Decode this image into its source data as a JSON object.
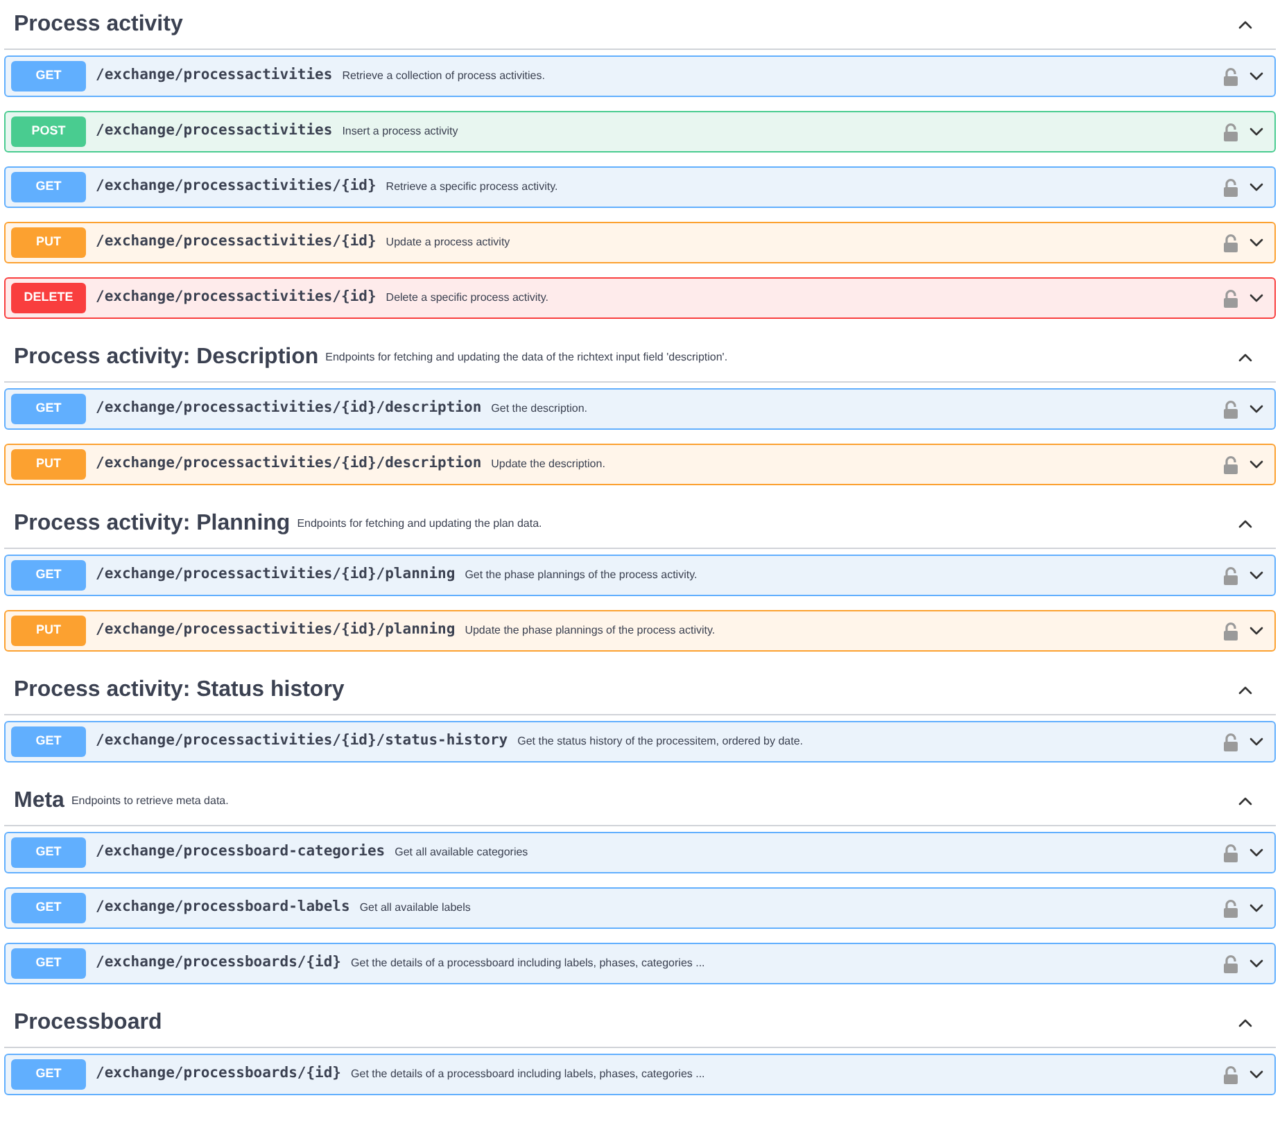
{
  "sections": [
    {
      "title": "Process activity",
      "expanded": true,
      "operations": [
        {
          "method": "GET",
          "path": "/exchange/processactivities",
          "summary": "Retrieve a collection of process activities."
        },
        {
          "method": "POST",
          "path": "/exchange/processactivities",
          "summary": "Insert a process activity"
        },
        {
          "method": "GET",
          "path": "/exchange/processactivities/{id}",
          "summary": "Retrieve a specific process activity."
        },
        {
          "method": "PUT",
          "path": "/exchange/processactivities/{id}",
          "summary": "Update a process activity"
        },
        {
          "method": "DELETE",
          "path": "/exchange/processactivities/{id}",
          "summary": "Delete a specific process activity."
        }
      ]
    },
    {
      "title": "Process activity: Description",
      "description": "Endpoints for fetching and updating the data of the richtext input field 'description'.",
      "expanded": true,
      "operations": [
        {
          "method": "GET",
          "path": "/exchange/processactivities/{id}/description",
          "summary": "Get the description."
        },
        {
          "method": "PUT",
          "path": "/exchange/processactivities/{id}/description",
          "summary": "Update the description."
        }
      ]
    },
    {
      "title": "Process activity: Planning",
      "description": "Endpoints for fetching and updating the plan data.",
      "expanded": true,
      "operations": [
        {
          "method": "GET",
          "path": "/exchange/processactivities/{id}/planning",
          "summary": "Get the phase plannings of the process activity."
        },
        {
          "method": "PUT",
          "path": "/exchange/processactivities/{id}/planning",
          "summary": "Update the phase plannings of the process activity."
        }
      ]
    },
    {
      "title": "Process activity: Status history",
      "expanded": true,
      "operations": [
        {
          "method": "GET",
          "path": "/exchange/processactivities/{id}/status-history",
          "summary": "Get the status history of the processitem, ordered by date."
        }
      ]
    },
    {
      "title": "Meta",
      "description": "Endpoints to retrieve meta data.",
      "expanded": true,
      "operations": [
        {
          "method": "GET",
          "path": "/exchange/processboard-categories",
          "summary": "Get all available categories"
        },
        {
          "method": "GET",
          "path": "/exchange/processboard-labels",
          "summary": "Get all available labels"
        },
        {
          "method": "GET",
          "path": "/exchange/processboards/{id}",
          "summary": "Get the details of a processboard including labels, phases, categories ..."
        }
      ]
    },
    {
      "title": "Processboard",
      "expanded": true,
      "operations": [
        {
          "method": "GET",
          "path": "/exchange/processboards/{id}",
          "summary": "Get the details of a processboard including labels, phases, categories ..."
        }
      ]
    }
  ]
}
